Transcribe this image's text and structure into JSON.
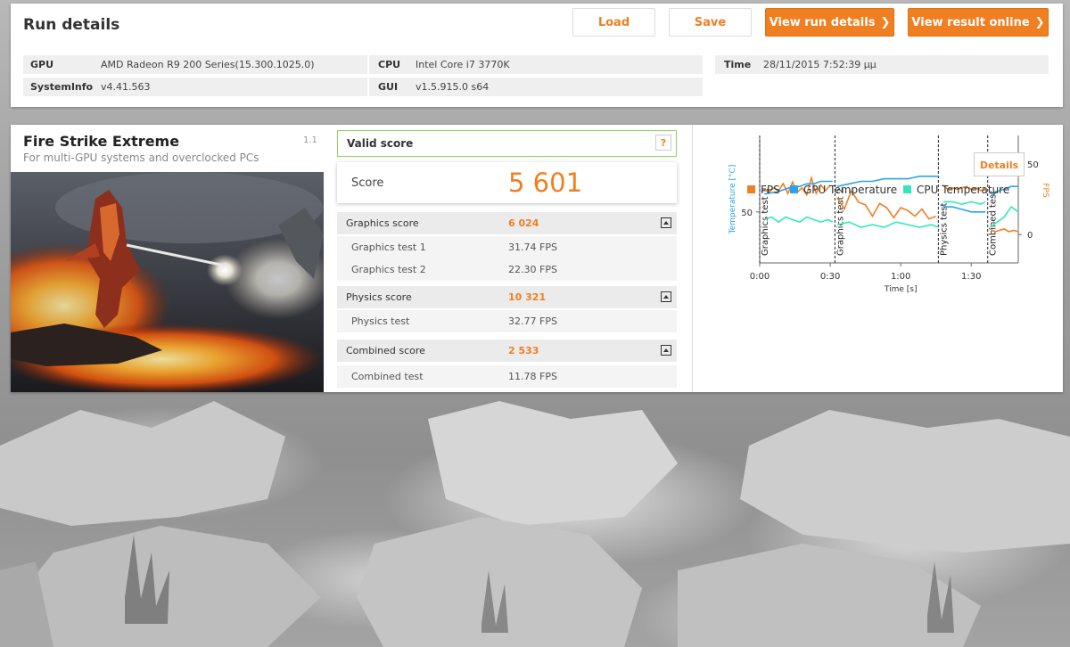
{
  "run_details": {
    "title": "Run details",
    "buttons": {
      "load": "Load",
      "save": "Save",
      "view_run_details": "View run details",
      "view_result_online": "View result online"
    },
    "info": {
      "gpu_label": "GPU",
      "gpu_value": "AMD Radeon R9 200 Series(15.300.1025.0)",
      "systeminfo_label": "SystemInfo",
      "systeminfo_value": "v4.41.563",
      "cpu_label": "CPU",
      "cpu_value": "Intel Core i7 3770K",
      "gui_label": "GUI",
      "gui_value": "v1.5.915.0 s64",
      "time_label": "Time",
      "time_value": "28/11/2015 7:52:39 μμ"
    }
  },
  "test": {
    "name": "Fire Strike Extreme",
    "subtitle": "For multi-GPU systems and overclocked PCs",
    "version": "1.1"
  },
  "score": {
    "valid_label": "Valid score",
    "help_label": "?",
    "score_label": "Score",
    "score_value": "5 601",
    "graphics_label": "Graphics score",
    "graphics_value": "6 024",
    "gt1_label": "Graphics test 1",
    "gt1_value": "31.74 FPS",
    "gt2_label": "Graphics test 2",
    "gt2_value": "22.30 FPS",
    "physics_label": "Physics score",
    "physics_value": "10 321",
    "pt_label": "Physics test",
    "pt_value": "32.77 FPS",
    "combined_label": "Combined score",
    "combined_value": "2 533",
    "ct_label": "Combined test",
    "ct_value": "11.78 FPS"
  },
  "chart_data": {
    "type": "line",
    "xlabel": "Time [s]",
    "ylabel_left": "Temperature [°C]",
    "ylabel_right": "FPS",
    "x_ticks": [
      "0:00",
      "0:30",
      "1:00",
      "1:30"
    ],
    "y_left_ticks": [
      "50"
    ],
    "y_right_ticks": [
      "50",
      "0"
    ],
    "xlim": [
      0,
      110
    ],
    "y_left_lim": [
      30,
      80
    ],
    "y_right_lim": [
      -20,
      70
    ],
    "sections": [
      {
        "label": "Graphics test 1",
        "start": 0
      },
      {
        "label": "Graphics test 2",
        "start": 32
      },
      {
        "label": "Physics test",
        "start": 76
      },
      {
        "label": "Combined test",
        "start": 97
      }
    ],
    "series": [
      {
        "name": "FPS",
        "axis": "right",
        "color": "#f07f21",
        "segments": [
          {
            "x": [
              2,
              4,
              6,
              8,
              10,
              12,
              14,
              16,
              18,
              20,
              22,
              24,
              26,
              28,
              30
            ],
            "y": [
              32,
              30,
              33,
              31,
              36,
              29,
              37,
              30,
              33,
              28,
              40,
              29,
              35,
              31,
              35
            ]
          },
          {
            "x": [
              33,
              36,
              39,
              42,
              45,
              48,
              51,
              54,
              57,
              60,
              63,
              66,
              69,
              72,
              75
            ],
            "y": [
              26,
              18,
              31,
              23,
              21,
              13,
              22,
              19,
              12,
              19,
              17,
              13,
              18,
              11,
              13
            ]
          },
          {
            "x": [
              78,
              80,
              82,
              84,
              86,
              88,
              90,
              92,
              94,
              96
            ],
            "y": [
              35,
              32,
              33,
              32,
              33,
              34,
              32,
              33,
              31,
              33
            ]
          },
          {
            "x": [
              98,
              100,
              102,
              104,
              106,
              108,
              110
            ],
            "y": [
              4,
              2,
              3,
              4,
              2,
              3,
              2
            ]
          }
        ]
      },
      {
        "name": "GPU Temperature",
        "axis": "left",
        "color": "#2aa3ef",
        "segments": [
          {
            "x": [
              2,
              5,
              8,
              11,
              14,
              17,
              20,
              23,
              26,
              29,
              31
            ],
            "y": [
              57,
              57.5,
              58,
              59,
              60,
              60,
              61,
              61,
              62,
              62,
              62
            ]
          },
          {
            "x": [
              33,
              38,
              43,
              48,
              53,
              58,
              63,
              68,
              73,
              76
            ],
            "y": [
              60,
              61,
              62,
              62,
              63,
              63,
              63,
              64,
              64,
              64
            ]
          },
          {
            "x": [
              78,
              82,
              86,
              90,
              94,
              96
            ],
            "y": [
              52,
              52,
              51,
              50,
              50,
              50
            ]
          },
          {
            "x": [
              98,
              101,
              104,
              107,
              110
            ],
            "y": [
              56,
              58,
              59,
              60,
              60
            ]
          }
        ]
      },
      {
        "name": "CPU Temperature",
        "axis": "left",
        "color": "#33e8b8",
        "segments": [
          {
            "x": [
              2,
              5,
              8,
              11,
              14,
              17,
              20,
              23,
              26,
              29,
              31
            ],
            "y": [
              47,
              48,
              46,
              48,
              47,
              46,
              48,
              47,
              46,
              47,
              46
            ]
          },
          {
            "x": [
              33,
              38,
              43,
              48,
              53,
              58,
              63,
              68,
              73,
              76
            ],
            "y": [
              45,
              46,
              44,
              45,
              44,
              46,
              45,
              44,
              45,
              44
            ]
          },
          {
            "x": [
              78,
              82,
              86,
              90,
              94,
              96
            ],
            "y": [
              54,
              54,
              53,
              54,
              53,
              54
            ]
          },
          {
            "x": [
              98,
              101,
              104,
              107,
              110
            ],
            "y": [
              44,
              46,
              48,
              52,
              50
            ]
          }
        ]
      }
    ],
    "legend": [
      "FPS",
      "GPU Temperature",
      "CPU Temperature"
    ],
    "legend_position": "bottom",
    "details_label": "Details"
  }
}
